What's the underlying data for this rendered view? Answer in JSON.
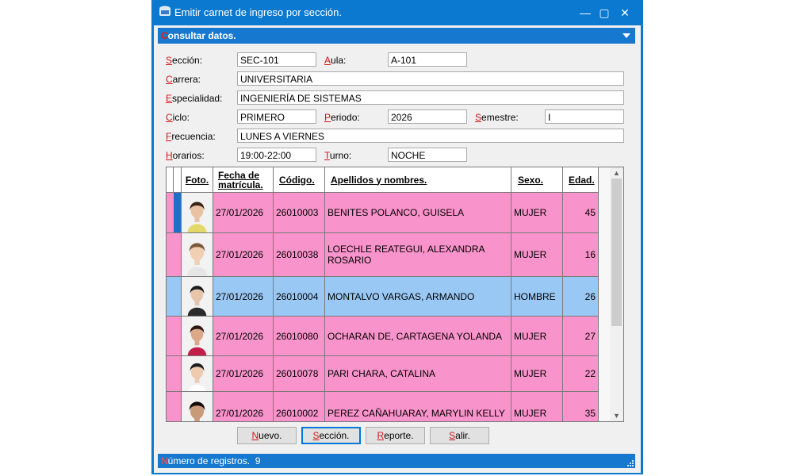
{
  "window": {
    "title": "Emitir carnet de ingreso por sección.",
    "minimize_glyph": "—",
    "maximize_glyph": "▢",
    "close_glyph": "✕"
  },
  "section": {
    "first_letter": "C",
    "rest": "onsultar datos."
  },
  "form": {
    "seccion": {
      "label_first": "S",
      "label_rest": "ección:",
      "value": "SEC-101"
    },
    "aula": {
      "label_first": "A",
      "label_rest": "ula:",
      "value": "A-101"
    },
    "carrera": {
      "label_first": "C",
      "label_rest": "arrera:",
      "value": "UNIVERSITARIA"
    },
    "especialidad": {
      "label_first": "E",
      "label_rest": "specialidad:",
      "value": "INGENIERÍA DE SISTEMAS"
    },
    "ciclo": {
      "label_first": "C",
      "label_rest": "iclo:",
      "value": "PRIMERO"
    },
    "periodo": {
      "label_first": "P",
      "label_rest": "eriodo:",
      "value": "2026"
    },
    "semestre": {
      "label_first": "S",
      "label_rest": "emestre:",
      "value": "I"
    },
    "frecuencia": {
      "label_first": "F",
      "label_rest": "recuencia:",
      "value": "LUNES A VIERNES"
    },
    "horarios": {
      "label_first": "H",
      "label_rest": "orarios:",
      "value": "19:00-22:00"
    },
    "turno": {
      "label_first": "T",
      "label_rest": "urno:",
      "value": "NOCHE"
    }
  },
  "table": {
    "headers": {
      "foto": "Foto.",
      "fecha_line1": "Fecha de",
      "fecha_line2": "matrícula.",
      "codigo": "Código.",
      "nombres": "Apellidos y nombres.",
      "sexo": "Sexo.",
      "edad": "Edad."
    },
    "rows": [
      {
        "fecha": "27/01/2026",
        "codigo": "26010003",
        "nombre": "BENITES POLANCO, GUISELA",
        "sexo": "MUJER",
        "edad": "45",
        "color": "#f993cb",
        "selected": true
      },
      {
        "fecha": "27/01/2026",
        "codigo": "26010038",
        "nombre": "LOECHLE REATEGUI, ALEXANDRA ROSARIO",
        "sexo": "MUJER",
        "edad": "16",
        "color": "#f993cb"
      },
      {
        "fecha": "27/01/2026",
        "codigo": "26010004",
        "nombre": "MONTALVO VARGAS, ARMANDO",
        "sexo": "HOMBRE",
        "edad": "26",
        "color": "#9ac8f5"
      },
      {
        "fecha": "27/01/2026",
        "codigo": "26010080",
        "nombre": "OCHARAN DE, CARTAGENA YOLANDA",
        "sexo": "MUJER",
        "edad": "27",
        "color": "#f993cb"
      },
      {
        "fecha": "27/01/2026",
        "codigo": "26010078",
        "nombre": "PARI CHARA, CATALINA",
        "sexo": "MUJER",
        "edad": "22",
        "color": "#f993cb"
      },
      {
        "fecha": "27/01/2026",
        "codigo": "26010002",
        "nombre": "PEREZ CAÑAHUARAY, MARYLIN KELLY",
        "sexo": "MUJER",
        "edad": "35",
        "color": "#f993cb"
      }
    ]
  },
  "buttons": {
    "nuevo": {
      "first": "N",
      "rest": "uevo."
    },
    "seccion": {
      "first": "S",
      "rest": "ección."
    },
    "reporte": {
      "first": "R",
      "rest": "eporte."
    },
    "salir": {
      "first": "S",
      "rest": "alir."
    }
  },
  "status": {
    "first_letter": "N",
    "label_rest": "úmero de registros.",
    "count": "9"
  },
  "colors": {
    "accent": "#0b79d0",
    "female_row": "#f993cb",
    "male_row": "#9ac8f5",
    "selected_marker": "#1f6fc6",
    "mnemonic": "#d01818"
  }
}
